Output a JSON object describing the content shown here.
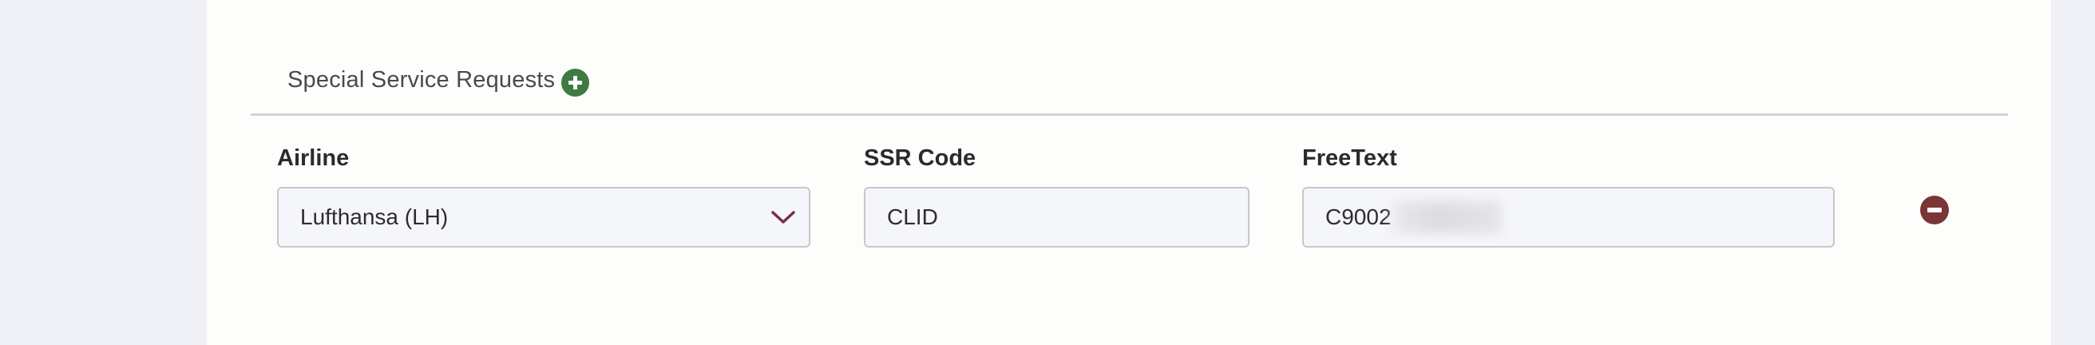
{
  "section": {
    "title": "Special Service Requests"
  },
  "fields": {
    "airline": {
      "label": "Airline",
      "value": "Lufthansa (LH)"
    },
    "ssr_code": {
      "label": "SSR Code",
      "value": "CLID"
    },
    "free_text": {
      "label": "FreeText",
      "value": "C9002"
    }
  },
  "icons": {
    "add": "plus-circle-icon",
    "remove": "minus-circle-icon",
    "dropdown": "chevron-down-icon"
  },
  "colors": {
    "add_button": "#3f7a43",
    "remove_button": "#7a3535",
    "chevron": "#7b2e45"
  }
}
